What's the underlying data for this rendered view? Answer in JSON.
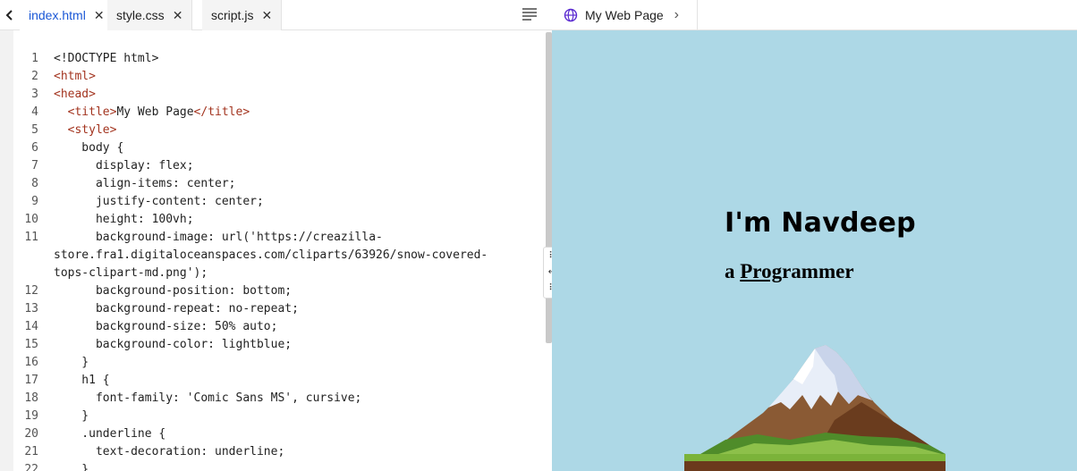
{
  "editor": {
    "tabs": [
      {
        "label": "index.html",
        "active": true
      },
      {
        "label": "style.css",
        "active": false
      },
      {
        "label": "script.js",
        "active": false
      }
    ],
    "lines": [
      {
        "n": "1",
        "parts": [
          {
            "t": "<!DOCTYPE html>",
            "c": "plain"
          }
        ]
      },
      {
        "n": "2",
        "parts": [
          {
            "t": "<html>",
            "c": "tag"
          }
        ]
      },
      {
        "n": "3",
        "parts": [
          {
            "t": "<head>",
            "c": "tag"
          }
        ]
      },
      {
        "n": "4",
        "parts": [
          {
            "t": "  ",
            "c": "plain"
          },
          {
            "t": "<title>",
            "c": "tag"
          },
          {
            "t": "My Web Page",
            "c": "plain"
          },
          {
            "t": "</title>",
            "c": "tag"
          }
        ]
      },
      {
        "n": "5",
        "parts": [
          {
            "t": "  ",
            "c": "plain"
          },
          {
            "t": "<style>",
            "c": "tag"
          }
        ]
      },
      {
        "n": "6",
        "parts": [
          {
            "t": "    body {",
            "c": "plain"
          }
        ]
      },
      {
        "n": "7",
        "parts": [
          {
            "t": "      display: flex;",
            "c": "plain"
          }
        ]
      },
      {
        "n": "8",
        "parts": [
          {
            "t": "      align-items: center;",
            "c": "plain"
          }
        ]
      },
      {
        "n": "9",
        "parts": [
          {
            "t": "      justify-content: center;",
            "c": "plain"
          }
        ]
      },
      {
        "n": "10",
        "parts": [
          {
            "t": "      height: 100vh;",
            "c": "plain"
          }
        ]
      },
      {
        "n": "11",
        "parts": [
          {
            "t": "      background-image: url('https://creazilla-",
            "c": "plain"
          }
        ]
      },
      {
        "n": "",
        "parts": [
          {
            "t": "store.fra1.digitaloceanspaces.com/cliparts/63926/snow-covered-",
            "c": "plain"
          }
        ]
      },
      {
        "n": "",
        "parts": [
          {
            "t": "tops-clipart-md.png');",
            "c": "plain"
          }
        ]
      },
      {
        "n": "12",
        "parts": [
          {
            "t": "      background-position: bottom;",
            "c": "plain"
          }
        ]
      },
      {
        "n": "13",
        "parts": [
          {
            "t": "      background-repeat: no-repeat;",
            "c": "plain"
          }
        ]
      },
      {
        "n": "14",
        "parts": [
          {
            "t": "      background-size: 50% auto;",
            "c": "plain"
          }
        ]
      },
      {
        "n": "15",
        "parts": [
          {
            "t": "      background-color: lightblue;",
            "c": "plain"
          }
        ]
      },
      {
        "n": "16",
        "parts": [
          {
            "t": "    }",
            "c": "plain"
          }
        ]
      },
      {
        "n": "17",
        "parts": [
          {
            "t": "    h1 {",
            "c": "plain"
          }
        ]
      },
      {
        "n": "18",
        "parts": [
          {
            "t": "      font-family: 'Comic Sans MS', cursive;",
            "c": "plain"
          }
        ]
      },
      {
        "n": "19",
        "parts": [
          {
            "t": "    }",
            "c": "plain"
          }
        ]
      },
      {
        "n": "20",
        "parts": [
          {
            "t": "    .underline {",
            "c": "plain"
          }
        ]
      },
      {
        "n": "21",
        "parts": [
          {
            "t": "      text-decoration: underline;",
            "c": "plain"
          }
        ]
      },
      {
        "n": "22",
        "parts": [
          {
            "t": "    }",
            "c": "plain"
          }
        ]
      }
    ]
  },
  "splitter": {
    "top_glyph": "⠿",
    "mid_glyph": "↔",
    "bottom_glyph": "⠿"
  },
  "preview": {
    "tab_label": "My Web Page",
    "heading": "I'm Navdeep",
    "sub_prefix": "a ",
    "sub_underlined": "Prog",
    "sub_rest": "rammer",
    "background_color": "#add8e6"
  },
  "colors": {
    "accent": "#1a57d6",
    "tag": "#a3341f"
  },
  "icons": {
    "back": "chevron-left-icon",
    "menu": "menu-lines-icon",
    "globe": "globe-icon",
    "chevron": "chevron-right-icon",
    "close": "close-icon"
  }
}
